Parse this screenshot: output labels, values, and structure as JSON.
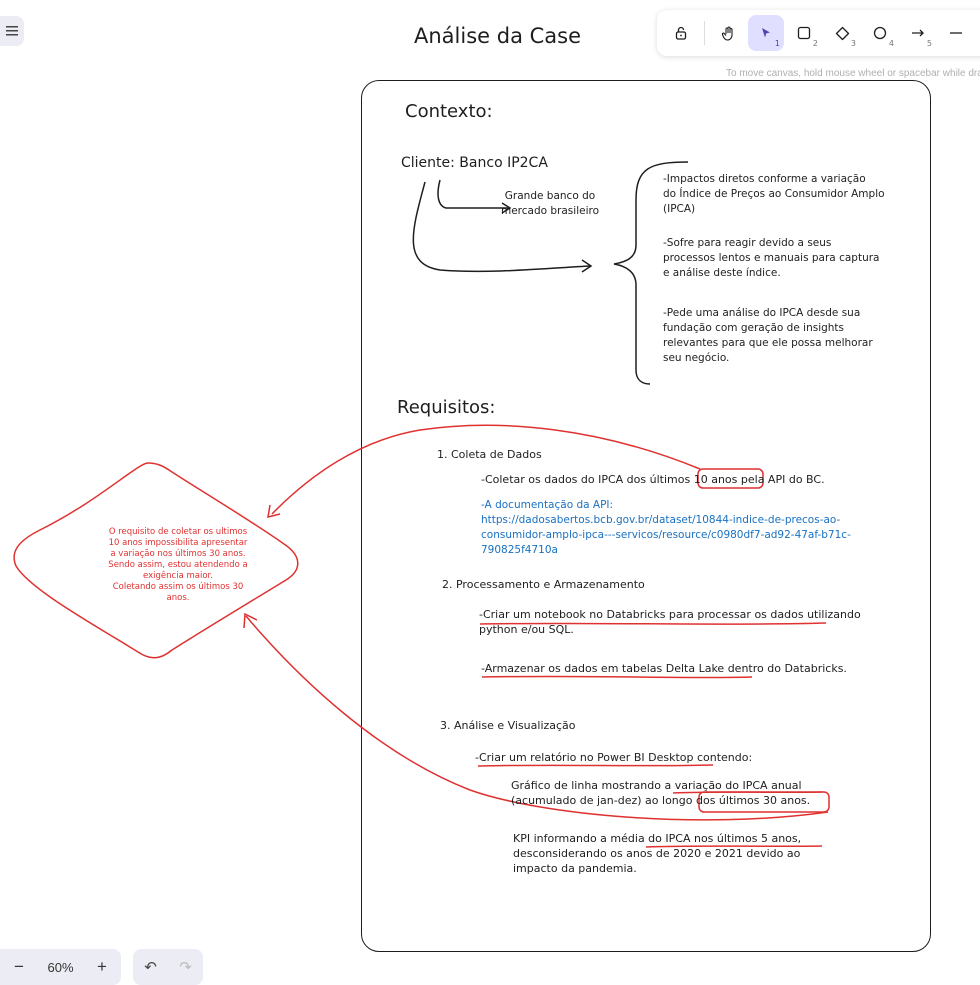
{
  "toolbar": {
    "tools": [
      {
        "name": "lock",
        "key": ""
      },
      {
        "name": "hand",
        "key": ""
      },
      {
        "name": "selection",
        "key": "1"
      },
      {
        "name": "rectangle",
        "key": "2"
      },
      {
        "name": "diamond",
        "key": "3"
      },
      {
        "name": "ellipse",
        "key": "4"
      },
      {
        "name": "arrow",
        "key": "5"
      },
      {
        "name": "line",
        "key": ""
      }
    ],
    "k1": "1",
    "k2": "2",
    "k3": "3",
    "k4": "4",
    "k5": "5"
  },
  "hint": "To move canvas, hold mouse wheel or spacebar while dragging",
  "canvas": {
    "title": "Análise da Case",
    "contexto_heading": "Contexto:",
    "cliente": "Cliente: Banco IP2CA",
    "cliente_desc_1": "Grande banco do",
    "cliente_desc_2": "mercado brasileiro",
    "impactos": [
      "-Impactos diretos conforme a variação",
      "do Índice de Preços ao Consumidor Amplo",
      "(IPCA)"
    ],
    "sofre": [
      "-Sofre para reagir devido a seus",
      "processos lentos e manuais para captura",
      "e análise deste índice."
    ],
    "pede": [
      "-Pede uma análise do IPCA desde sua",
      "fundação com geração de insights",
      "relevantes para que ele possa melhorar",
      "seu negócio."
    ],
    "requisitos_heading": "Requisitos:",
    "req1_title": "1. Coleta de Dados",
    "req1_a": "-Coletar os dados do IPCA dos",
    "req1_b": "últimos 10 anos",
    "req1_c": "pela API do BC.",
    "api_lines": [
      "-A documentação da API:",
      "https://dadosabertos.bcb.gov.br/dataset/10844-indice-de-precos-ao-",
      "consumidor-amplo-ipca---servicos/resource/c0980df7-ad92-47af-b71c-",
      "790825f4710a"
    ],
    "req2_title": "2. Processamento e Armazenamento",
    "req2_a1": "-Criar um notebook no Databricks para processar os dados utilizando",
    "req2_a2": "python e/ou SQL.",
    "req2_b": "-Armazenar os dados em tabelas Delta Lake dentro do Databricks.",
    "req3_title": "3. Análise e Visualização",
    "req3_a": "-Criar um relatório no Power BI Desktop contendo:",
    "graf_1": "Gráfico de linha mostrando a variação do IPCA anual",
    "graf_2a": "(acumulado de jan-dez) ao longo dos",
    "graf_2b": "últimos 30 anos.",
    "kpi": [
      "KPI informando a média do IPCA nos últimos 5 anos,",
      "desconsiderando os anos de 2020 e 2021 devido ao",
      "impacto da pandemia."
    ],
    "note": [
      "O requisito de coletar os ultimos",
      "10 anos impossibilita apresentar",
      "a variação nos últimos 30 anos.",
      "Sendo assim, estou atendendo a",
      "exigência maior.",
      "Coletando assim os últimos 30",
      "anos."
    ]
  },
  "zoom": {
    "minus": "−",
    "value": "60%",
    "plus": "+"
  },
  "history": {
    "undo": "↶",
    "redo": "↷"
  },
  "colors": {
    "stroke": "#1e1e1e",
    "red": "#e03131",
    "blue": "#1971c2",
    "accent": "#e0dfff"
  }
}
